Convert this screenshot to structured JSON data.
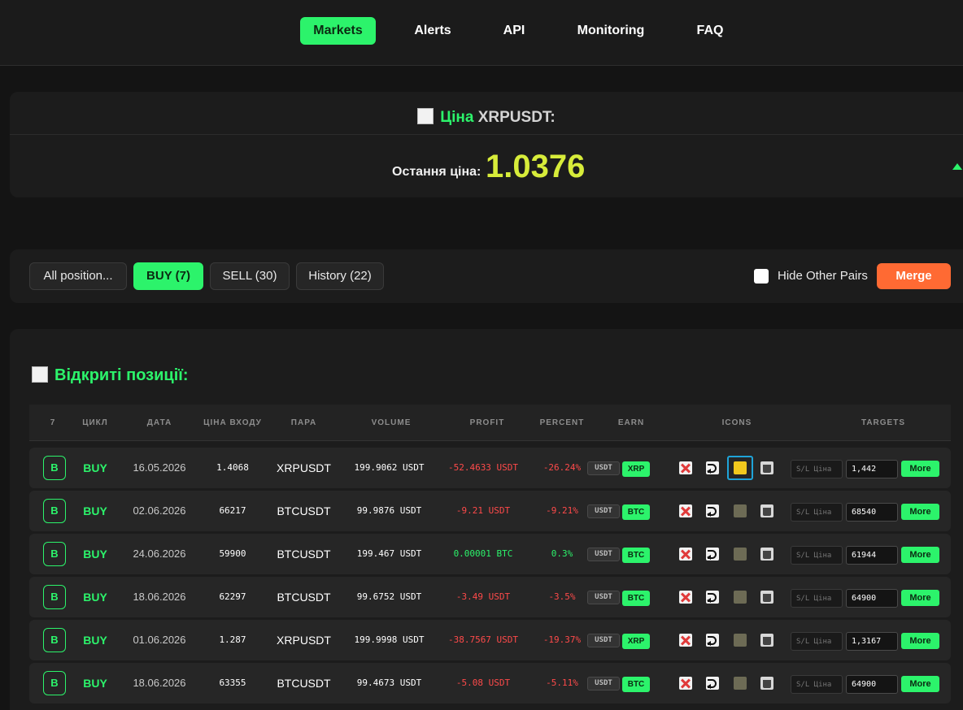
{
  "nav": {
    "items": [
      {
        "label": "Markets",
        "active": true
      },
      {
        "label": "Alerts",
        "active": false
      },
      {
        "label": "API",
        "active": false
      },
      {
        "label": "Monitoring",
        "active": false
      },
      {
        "label": "FAQ",
        "active": false
      }
    ]
  },
  "price": {
    "title_prefix": "Ціна",
    "symbol": "XRPUSDT:",
    "last_label": "Остання ціна:",
    "last_value": "1.0376",
    "trend": "up"
  },
  "filters": {
    "all_label": "All position...",
    "buy_label": "BUY (7)",
    "sell_label": "SELL (30)",
    "history_label": "History (22)",
    "hide_other_pairs_label": "Hide Other Pairs",
    "hide_other_pairs_checked": false,
    "merge_label": "Merge"
  },
  "positions": {
    "title": "Відкриті позиції:",
    "headers": {
      "count": "7",
      "cycle": "ЦИКЛ",
      "date": "ДАТА",
      "entry": "ЦІНА ВХОДУ",
      "pair": "ПАРА",
      "volume": "VOLUME",
      "profit": "PROFIT",
      "percent": "PERCENT",
      "earn": "EARN",
      "icons": "ICONS",
      "targets": "TARGETS"
    },
    "sl_placeholder": "S/L Ціна",
    "more_label": "More",
    "earn_usdt": "USDT",
    "rows": [
      {
        "badge": "B",
        "side": "BUY",
        "date": "16.05.2026",
        "entry": "1.4068",
        "pair": "XRPUSDT",
        "volume": "199.9062 USDT",
        "profit": "-52.4633 USDT",
        "percent": "-26.24%",
        "earn": "XRP",
        "target": "1,442",
        "sign": "neg",
        "bell_active": true
      },
      {
        "badge": "B",
        "side": "BUY",
        "date": "02.06.2026",
        "entry": "66217",
        "pair": "BTCUSDT",
        "volume": "99.9876 USDT",
        "profit": "-9.21 USDT",
        "percent": "-9.21%",
        "earn": "BTC",
        "target": "68540",
        "sign": "neg",
        "bell_active": false
      },
      {
        "badge": "B",
        "side": "BUY",
        "date": "24.06.2026",
        "entry": "59900",
        "pair": "BTCUSDT",
        "volume": "199.467 USDT",
        "profit": "0.00001 BTC",
        "percent": "0.3%",
        "earn": "BTC",
        "target": "61944",
        "sign": "pos",
        "bell_active": false
      },
      {
        "badge": "B",
        "side": "BUY",
        "date": "18.06.2026",
        "entry": "62297",
        "pair": "BTCUSDT",
        "volume": "99.6752 USDT",
        "profit": "-3.49 USDT",
        "percent": "-3.5%",
        "earn": "BTC",
        "target": "64900",
        "sign": "neg",
        "bell_active": false
      },
      {
        "badge": "B",
        "side": "BUY",
        "date": "01.06.2026",
        "entry": "1.287",
        "pair": "XRPUSDT",
        "volume": "199.9998 USDT",
        "profit": "-38.7567 USDT",
        "percent": "-19.37%",
        "earn": "XRP",
        "target": "1,3167",
        "sign": "neg",
        "bell_active": false
      },
      {
        "badge": "B",
        "side": "BUY",
        "date": "18.06.2026",
        "entry": "63355",
        "pair": "BTCUSDT",
        "volume": "99.4673 USDT",
        "profit": "-5.08 USDT",
        "percent": "-5.11%",
        "earn": "BTC",
        "target": "64900",
        "sign": "neg",
        "bell_active": false
      }
    ]
  },
  "colors": {
    "accent": "#2cf36b",
    "negative": "#ff4a4a",
    "merge": "#ff6a33",
    "price": "#d7ec3a"
  }
}
